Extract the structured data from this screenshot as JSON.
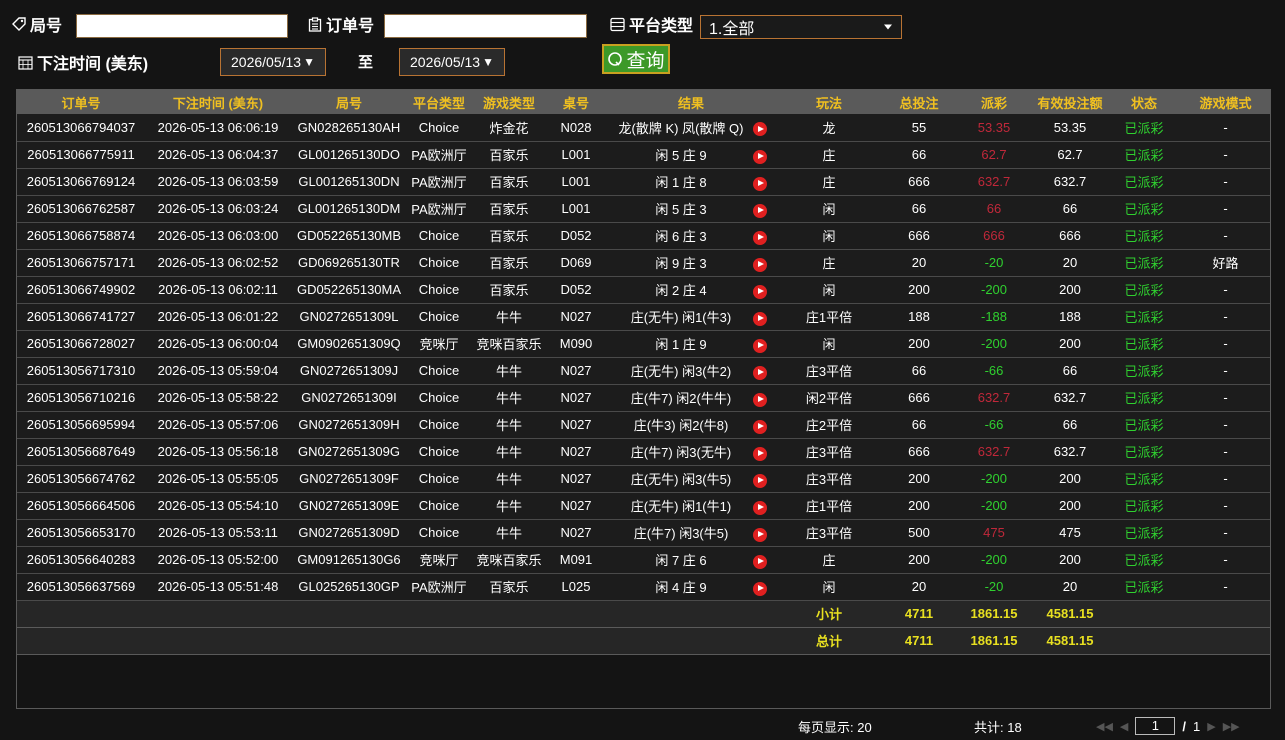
{
  "filters": {
    "round_label": "局号",
    "round_value": "",
    "order_label": "订单号",
    "order_value": "",
    "platform_label": "平台类型",
    "platform_value": "1.全部",
    "time_label": "下注时间 (美东)",
    "date_from": "2026/05/13",
    "to_label": "至",
    "date_to": "2026/05/13",
    "query_label": "查询"
  },
  "table": {
    "headers": [
      "订单号",
      "下注时间 (美东)",
      "局号",
      "平台类型",
      "游戏类型",
      "桌号",
      "结果",
      "玩法",
      "总投注",
      "派彩",
      "有效投注额",
      "状态",
      "游戏模式"
    ],
    "rows": [
      {
        "order": "260513066794037",
        "time": "2026-05-13 06:06:19",
        "round": "GN028265130AH",
        "platform": "Choice",
        "game": "炸金花",
        "table_no": "N028",
        "result": "龙(散牌 K) 凤(散牌 Q)",
        "play": "龙",
        "bet": "55",
        "payout": "53.35",
        "payout_color": "red",
        "valid": "53.35",
        "status": "已派彩",
        "mode": "-"
      },
      {
        "order": "260513066775911",
        "time": "2026-05-13 06:04:37",
        "round": "GL001265130DO",
        "platform": "PA欧洲厅",
        "game": "百家乐",
        "table_no": "L001",
        "result": "闲 5 庄 9",
        "play": "庄",
        "bet": "66",
        "payout": "62.7",
        "payout_color": "red",
        "valid": "62.7",
        "status": "已派彩",
        "mode": "-"
      },
      {
        "order": "260513066769124",
        "time": "2026-05-13 06:03:59",
        "round": "GL001265130DN",
        "platform": "PA欧洲厅",
        "game": "百家乐",
        "table_no": "L001",
        "result": "闲 1 庄 8",
        "play": "庄",
        "bet": "666",
        "payout": "632.7",
        "payout_color": "red",
        "valid": "632.7",
        "status": "已派彩",
        "mode": "-"
      },
      {
        "order": "260513066762587",
        "time": "2026-05-13 06:03:24",
        "round": "GL001265130DM",
        "platform": "PA欧洲厅",
        "game": "百家乐",
        "table_no": "L001",
        "result": "闲 5 庄 3",
        "play": "闲",
        "bet": "66",
        "payout": "66",
        "payout_color": "red",
        "valid": "66",
        "status": "已派彩",
        "mode": "-"
      },
      {
        "order": "260513066758874",
        "time": "2026-05-13 06:03:00",
        "round": "GD052265130MB",
        "platform": "Choice",
        "game": "百家乐",
        "table_no": "D052",
        "result": "闲 6 庄 3",
        "play": "闲",
        "bet": "666",
        "payout": "666",
        "payout_color": "red",
        "valid": "666",
        "status": "已派彩",
        "mode": "-"
      },
      {
        "order": "260513066757171",
        "time": "2026-05-13 06:02:52",
        "round": "GD069265130TR",
        "platform": "Choice",
        "game": "百家乐",
        "table_no": "D069",
        "result": "闲 9 庄 3",
        "play": "庄",
        "bet": "20",
        "payout": "-20",
        "payout_color": "green",
        "valid": "20",
        "status": "已派彩",
        "mode": "好路"
      },
      {
        "order": "260513066749902",
        "time": "2026-05-13 06:02:11",
        "round": "GD052265130MA",
        "platform": "Choice",
        "game": "百家乐",
        "table_no": "D052",
        "result": "闲 2 庄 4",
        "play": "闲",
        "bet": "200",
        "payout": "-200",
        "payout_color": "green",
        "valid": "200",
        "status": "已派彩",
        "mode": "-"
      },
      {
        "order": "260513066741727",
        "time": "2026-05-13 06:01:22",
        "round": "GN0272651309L",
        "platform": "Choice",
        "game": "牛牛",
        "table_no": "N027",
        "result": "庄(无牛) 闲1(牛3)",
        "play": "庄1平倍",
        "bet": "188",
        "payout": "-188",
        "payout_color": "green",
        "valid": "188",
        "status": "已派彩",
        "mode": "-"
      },
      {
        "order": "260513066728027",
        "time": "2026-05-13 06:00:04",
        "round": "GM0902651309Q",
        "platform": "竞咪厅",
        "game": "竞咪百家乐",
        "table_no": "M090",
        "result": "闲 1 庄 9",
        "play": "闲",
        "bet": "200",
        "payout": "-200",
        "payout_color": "green",
        "valid": "200",
        "status": "已派彩",
        "mode": "-"
      },
      {
        "order": "260513056717310",
        "time": "2026-05-13 05:59:04",
        "round": "GN0272651309J",
        "platform": "Choice",
        "game": "牛牛",
        "table_no": "N027",
        "result": "庄(无牛) 闲3(牛2)",
        "play": "庄3平倍",
        "bet": "66",
        "payout": "-66",
        "payout_color": "green",
        "valid": "66",
        "status": "已派彩",
        "mode": "-"
      },
      {
        "order": "260513056710216",
        "time": "2026-05-13 05:58:22",
        "round": "GN0272651309I",
        "platform": "Choice",
        "game": "牛牛",
        "table_no": "N027",
        "result": "庄(牛7) 闲2(牛牛)",
        "play": "闲2平倍",
        "bet": "666",
        "payout": "632.7",
        "payout_color": "red",
        "valid": "632.7",
        "status": "已派彩",
        "mode": "-"
      },
      {
        "order": "260513056695994",
        "time": "2026-05-13 05:57:06",
        "round": "GN0272651309H",
        "platform": "Choice",
        "game": "牛牛",
        "table_no": "N027",
        "result": "庄(牛3) 闲2(牛8)",
        "play": "庄2平倍",
        "bet": "66",
        "payout": "-66",
        "payout_color": "green",
        "valid": "66",
        "status": "已派彩",
        "mode": "-"
      },
      {
        "order": "260513056687649",
        "time": "2026-05-13 05:56:18",
        "round": "GN0272651309G",
        "platform": "Choice",
        "game": "牛牛",
        "table_no": "N027",
        "result": "庄(牛7) 闲3(无牛)",
        "play": "庄3平倍",
        "bet": "666",
        "payout": "632.7",
        "payout_color": "red",
        "valid": "632.7",
        "status": "已派彩",
        "mode": "-"
      },
      {
        "order": "260513056674762",
        "time": "2026-05-13 05:55:05",
        "round": "GN0272651309F",
        "platform": "Choice",
        "game": "牛牛",
        "table_no": "N027",
        "result": "庄(无牛) 闲3(牛5)",
        "play": "庄3平倍",
        "bet": "200",
        "payout": "-200",
        "payout_color": "green",
        "valid": "200",
        "status": "已派彩",
        "mode": "-"
      },
      {
        "order": "260513056664506",
        "time": "2026-05-13 05:54:10",
        "round": "GN0272651309E",
        "platform": "Choice",
        "game": "牛牛",
        "table_no": "N027",
        "result": "庄(无牛) 闲1(牛1)",
        "play": "庄1平倍",
        "bet": "200",
        "payout": "-200",
        "payout_color": "green",
        "valid": "200",
        "status": "已派彩",
        "mode": "-"
      },
      {
        "order": "260513056653170",
        "time": "2026-05-13 05:53:11",
        "round": "GN0272651309D",
        "platform": "Choice",
        "game": "牛牛",
        "table_no": "N027",
        "result": "庄(牛7) 闲3(牛5)",
        "play": "庄3平倍",
        "bet": "500",
        "payout": "475",
        "payout_color": "red",
        "valid": "475",
        "status": "已派彩",
        "mode": "-"
      },
      {
        "order": "260513056640283",
        "time": "2026-05-13 05:52:00",
        "round": "GM091265130G6",
        "platform": "竞咪厅",
        "game": "竞咪百家乐",
        "table_no": "M091",
        "result": "闲 7 庄 6",
        "play": "庄",
        "bet": "200",
        "payout": "-200",
        "payout_color": "green",
        "valid": "200",
        "status": "已派彩",
        "mode": "-"
      },
      {
        "order": "260513056637569",
        "time": "2026-05-13 05:51:48",
        "round": "GL025265130GP",
        "platform": "PA欧洲厅",
        "game": "百家乐",
        "table_no": "L025",
        "result": "闲 4 庄 9",
        "play": "闲",
        "bet": "20",
        "payout": "-20",
        "payout_color": "green",
        "valid": "20",
        "status": "已派彩",
        "mode": "-"
      }
    ],
    "subtotal": {
      "label": "小计",
      "bet": "4711",
      "payout": "1861.15",
      "valid": "4581.15"
    },
    "total": {
      "label": "总计",
      "bet": "4711",
      "payout": "1861.15",
      "valid": "4581.15"
    }
  },
  "pagination": {
    "per_page_label": "每页显示: 20",
    "total_label": "共计: 18",
    "current_page": "1",
    "separator": "/",
    "total_pages": "1"
  },
  "colors": {
    "red": "#c0283a",
    "green": "#2fd02f",
    "header_text": "#f0c020",
    "sum_text": "#e8e020",
    "accent_border": "#b87333"
  }
}
